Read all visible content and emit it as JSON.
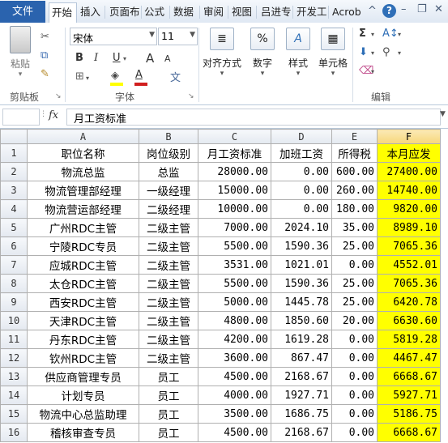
{
  "tabs": {
    "file": "文件",
    "items": [
      "开始",
      "插入",
      "页面布",
      "公式",
      "数据",
      "审阅",
      "视图",
      "吕进专",
      "开发工",
      "Acrob"
    ],
    "active_index": 0
  },
  "ribbon": {
    "clipboard": {
      "paste": "粘贴",
      "group": "剪贴板"
    },
    "font": {
      "name": "宋体",
      "size": "11",
      "bold": "B",
      "italic": "I",
      "underline": "U",
      "grow": "A",
      "shrink": "A",
      "font_color": "A",
      "wen": "文",
      "group": "字体"
    },
    "alignment": {
      "label": "对齐方式"
    },
    "number": {
      "label": "数字",
      "symbol": "%"
    },
    "styles": {
      "label": "样式",
      "symbol": "A"
    },
    "cells": {
      "label": "单元格"
    },
    "editing": {
      "group": "编辑",
      "sigma": "Σ"
    }
  },
  "formula_bar": {
    "fx": "fx",
    "content": "月工资标准"
  },
  "sheet": {
    "columns": [
      "A",
      "B",
      "C",
      "D",
      "E",
      "F"
    ],
    "selected_column": "F",
    "rows": [
      [
        "职位名称",
        "岗位级别",
        "月工资标准",
        "加班工资",
        "所得税",
        "本月应发"
      ],
      [
        "物流总监",
        "总监",
        "28000.00",
        "0.00",
        "600.00",
        "27400.00"
      ],
      [
        "物流管理部经理",
        "一级经理",
        "15000.00",
        "0.00",
        "260.00",
        "14740.00"
      ],
      [
        "物流营运部经理",
        "二级经理",
        "10000.00",
        "0.00",
        "180.00",
        "9820.00"
      ],
      [
        "广州RDC主管",
        "二级主管",
        "7000.00",
        "2024.10",
        "35.00",
        "8989.10"
      ],
      [
        "宁陵RDC专员",
        "二级主管",
        "5500.00",
        "1590.36",
        "25.00",
        "7065.36"
      ],
      [
        "应城RDC主管",
        "二级主管",
        "3531.00",
        "1021.01",
        "0.00",
        "4552.01"
      ],
      [
        "太仓RDC主管",
        "二级主管",
        "5500.00",
        "1590.36",
        "25.00",
        "7065.36"
      ],
      [
        "西安RDC主管",
        "二级主管",
        "5000.00",
        "1445.78",
        "25.00",
        "6420.78"
      ],
      [
        "天津RDC主管",
        "二级主管",
        "4800.00",
        "1850.60",
        "20.00",
        "6630.60"
      ],
      [
        "丹东RDC主管",
        "二级主管",
        "4200.00",
        "1619.28",
        "0.00",
        "5819.28"
      ],
      [
        "钦州RDC主管",
        "二级主管",
        "3600.00",
        "867.47",
        "0.00",
        "4467.47"
      ],
      [
        "供应商管理专员",
        "员工",
        "4500.00",
        "2168.67",
        "0.00",
        "6668.67"
      ],
      [
        "计划专员",
        "员工",
        "4000.00",
        "1927.71",
        "0.00",
        "5927.71"
      ],
      [
        "物流中心总监助理",
        "员工",
        "3500.00",
        "1686.75",
        "0.00",
        "5186.75"
      ],
      [
        "稽核审查专员",
        "员工",
        "4500.00",
        "2168.67",
        "0.00",
        "6668.67"
      ]
    ]
  },
  "colors": {
    "file_tab": "#2a63ae",
    "highlight": "#ffff00"
  }
}
